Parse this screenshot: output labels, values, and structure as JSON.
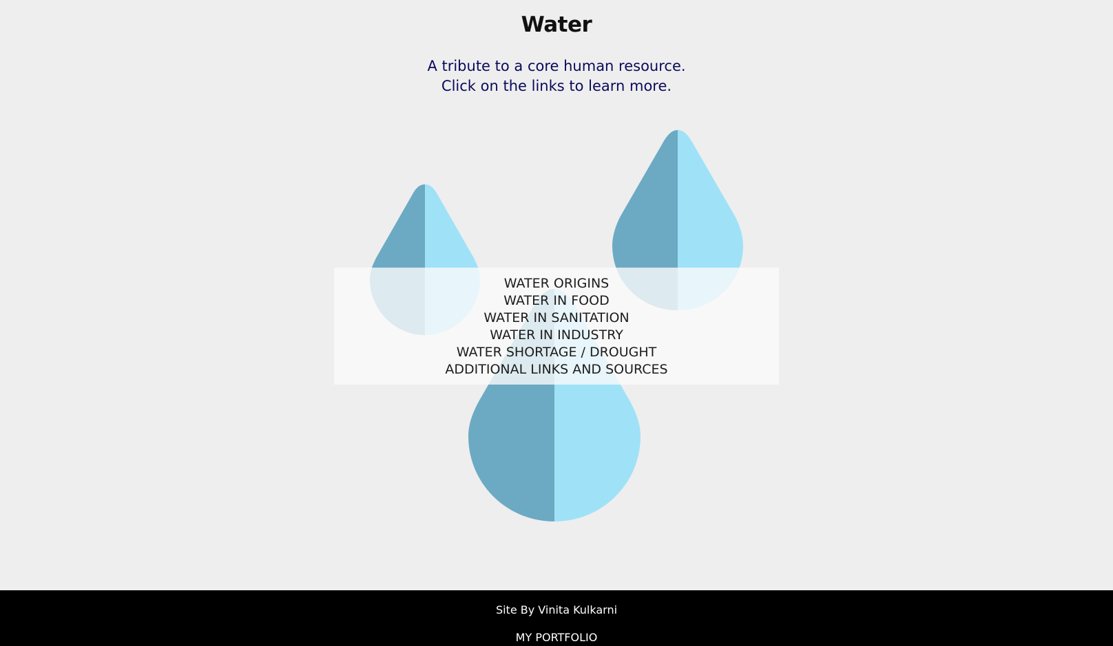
{
  "header": {
    "title": "Water",
    "subtitle_line1": "A tribute to a core human resource.",
    "subtitle_line2": "Click on the links to learn more."
  },
  "nav": {
    "links": [
      "WATER ORIGINS",
      "WATER IN FOOD",
      "WATER IN SANITATION",
      "WATER IN INDUSTRY",
      "WATER SHORTAGE / DROUGHT",
      "ADDITIONAL LINKS AND SOURCES"
    ]
  },
  "footer": {
    "credit": "Site By Vinita Kulkarni",
    "portfolio_link": "MY PORTFOLIO"
  },
  "colors": {
    "background": "#eeeeee",
    "drop_dark": "#6caac4",
    "drop_light": "#9fe2f8",
    "footer_bg": "#000000",
    "subtitle": "#0a0a5c"
  },
  "icons": [
    "water-drop-icon"
  ]
}
